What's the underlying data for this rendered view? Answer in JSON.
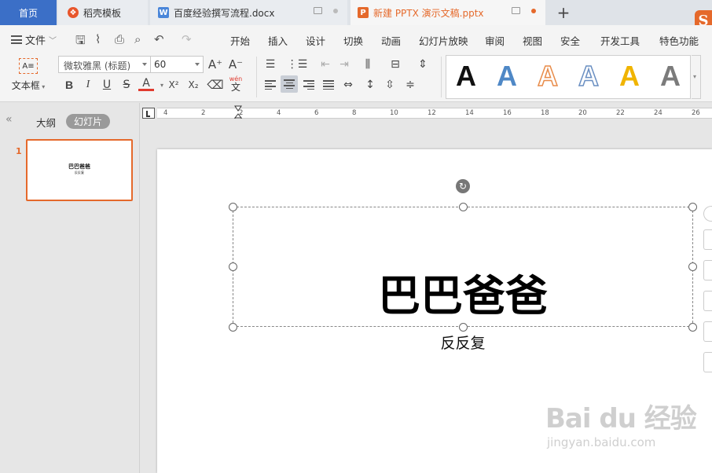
{
  "tabs": [
    {
      "label": "首页"
    },
    {
      "label": "稻壳模板"
    },
    {
      "label": "百度经验撰写流程.docx"
    },
    {
      "label": "新建 PPTX 演示文稿.pptx"
    }
  ],
  "tab_icons": [
    "wps-icon",
    "word-icon",
    "ppt-icon"
  ],
  "menubar": {
    "file_label": "文件",
    "items": [
      "开始",
      "插入",
      "设计",
      "切换",
      "动画",
      "幻灯片放映",
      "审阅",
      "视图",
      "安全",
      "开发工具",
      "特色功能"
    ]
  },
  "ribbon": {
    "textbox_label": "文本框",
    "textbox_icon_text": "A≡",
    "font_name": "微软雅黑 (标题)",
    "font_size": "60",
    "bold": "B",
    "italic": "I",
    "underline": "U",
    "strike": "S",
    "font_color": "A",
    "superscript": "X²",
    "subscript": "X₂",
    "phonetic": "wén",
    "phonetic_char": "文",
    "grow_font": "A⁺",
    "shrink_font": "A⁻",
    "art_letter": "A"
  },
  "art_styles": [
    {
      "name": "black-solid",
      "color": "#111111"
    },
    {
      "name": "blue-gradient",
      "color": "#4f88c6"
    },
    {
      "name": "orange-outline",
      "color": "#e88c4a"
    },
    {
      "name": "blue-outline",
      "color": "#6a8fc2"
    },
    {
      "name": "gold-solid",
      "color": "#f0b400"
    },
    {
      "name": "gray-gradient",
      "color": "#7b7b7b"
    }
  ],
  "left_panel": {
    "outline_tab": "大纲",
    "slides_tab": "幻灯片",
    "slide_number": "1",
    "thumb_title": "巴巴爸爸",
    "thumb_subtitle": "反反复"
  },
  "ruler": {
    "labels": [
      "4",
      "2",
      "2",
      "4",
      "6",
      "8",
      "10",
      "12",
      "14",
      "16",
      "18",
      "20",
      "22",
      "24",
      "26"
    ]
  },
  "slide": {
    "title": "巴巴爸爸",
    "subtitle": "反反复"
  },
  "watermark": {
    "brand": "Bai du 经验",
    "url": "jingyan.baidu.com"
  },
  "colors": {
    "accent": "#e5692b",
    "home_tab": "#3b6fc7",
    "ribbon_bg": "#f4f4f4"
  }
}
